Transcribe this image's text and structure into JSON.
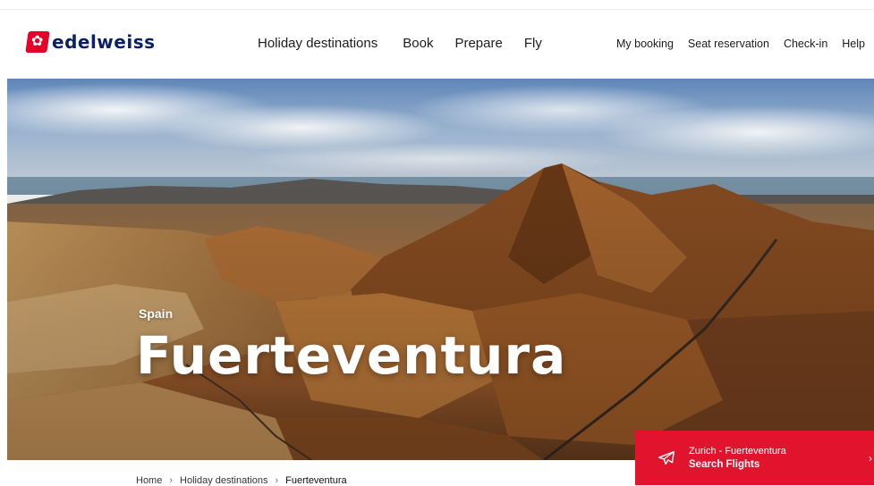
{
  "brand": {
    "name": "edelweiss",
    "color": "#e5002a",
    "text_color": "#0b1f66"
  },
  "main_nav": [
    "Holiday destinations",
    "Book",
    "Prepare",
    "Fly"
  ],
  "util_nav": [
    "My booking",
    "Seat reservation",
    "Check-in",
    "Help"
  ],
  "hero": {
    "country": "Spain",
    "title": "Fuerteventura"
  },
  "search_card": {
    "route": "Zurich - Fuerteventura",
    "cta": "Search Flights",
    "color": "#e2142d"
  },
  "breadcrumb": [
    "Home",
    "Holiday destinations",
    "Fuerteventura"
  ]
}
